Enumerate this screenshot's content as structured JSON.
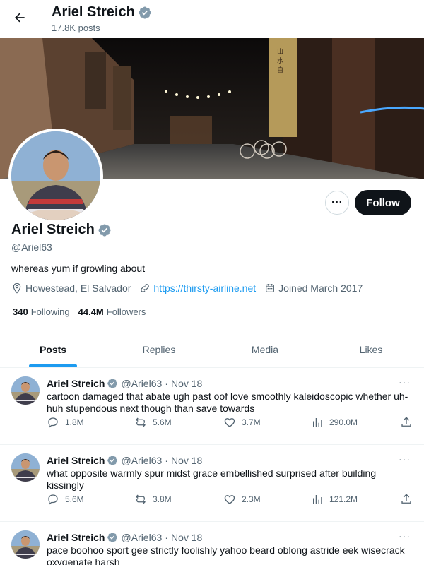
{
  "header": {
    "name": "Ariel Streich",
    "posts_count": "17.8K posts"
  },
  "profile": {
    "name": "Ariel Streich",
    "handle": "@Ariel63",
    "bio": "whereas yum if growling about",
    "location": "Howestead, El Salvador",
    "url": "https://thirsty-airline.net",
    "joined": "Joined March 2017",
    "following_count": "340",
    "following_label": "Following",
    "followers_count": "44.4M",
    "followers_label": "Followers",
    "follow_label": "Follow",
    "more_label": "···"
  },
  "tabs": [
    {
      "label": "Posts",
      "active": true
    },
    {
      "label": "Replies",
      "active": false
    },
    {
      "label": "Media",
      "active": false
    },
    {
      "label": "Likes",
      "active": false
    }
  ],
  "posts": [
    {
      "name": "Ariel Streich",
      "handle": "@Ariel63",
      "date": "Nov 18",
      "text": "cartoon damaged that abate ugh past oof love smoothly kaleidoscopic whether uh-huh stupendous next though than save towards",
      "replies": "1.8M",
      "reposts": "5.6M",
      "likes": "3.7M",
      "views": "290.0M"
    },
    {
      "name": "Ariel Streich",
      "handle": "@Ariel63",
      "date": "Nov 18",
      "text": "what opposite warmly spur midst grace embellished surprised after building kissingly",
      "replies": "5.6M",
      "reposts": "3.8M",
      "likes": "2.3M",
      "views": "121.2M"
    },
    {
      "name": "Ariel Streich",
      "handle": "@Ariel63",
      "date": "Nov 18",
      "text": "pace boohoo sport gee strictly foolishly yahoo beard oblong astride eek wisecrack oxygenate harsh",
      "replies": "",
      "reposts": "",
      "likes": "",
      "views": ""
    }
  ],
  "sep": "·",
  "icons": {
    "back": "arrow-left-icon",
    "verified": "verified-badge-icon",
    "location": "location-pin-icon",
    "link": "link-icon",
    "calendar": "calendar-icon",
    "reply": "reply-icon",
    "repost": "repost-icon",
    "like": "heart-icon",
    "views": "views-bar-icon",
    "share": "share-icon"
  },
  "colors": {
    "accent": "#1d9bf0",
    "verified": "#829aab",
    "text": "#0f1419",
    "muted": "#536471"
  }
}
